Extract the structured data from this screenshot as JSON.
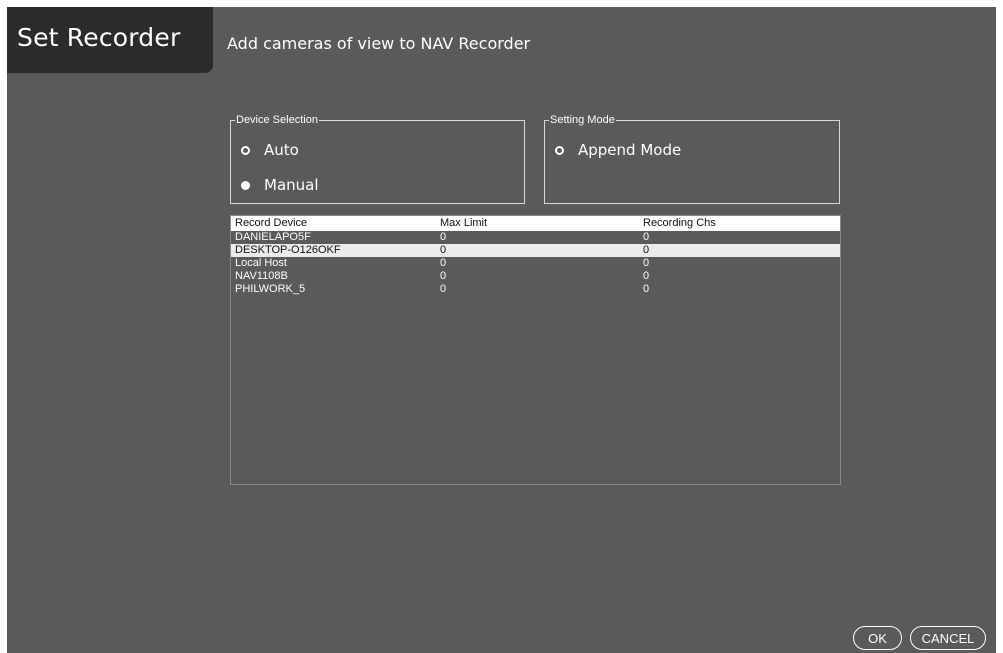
{
  "header": {
    "title": "Set Recorder",
    "subtitle": "Add cameras of view to NAV Recorder"
  },
  "device_selection": {
    "legend": "Device Selection",
    "options": [
      {
        "label": "Auto",
        "selected": false
      },
      {
        "label": "Manual",
        "selected": true
      }
    ]
  },
  "setting_mode": {
    "legend": "Setting Mode",
    "options": [
      {
        "label": "Append Mode",
        "selected": false
      }
    ]
  },
  "table": {
    "columns": [
      "Record Device",
      "Max Limit",
      "Recording Chs"
    ],
    "rows": [
      {
        "device": "DANIELAPO5F",
        "max_limit": "0",
        "recording_chs": "0",
        "selected": false
      },
      {
        "device": "DESKTOP-O126OKF",
        "max_limit": "0",
        "recording_chs": "0",
        "selected": true
      },
      {
        "device": "Local Host",
        "max_limit": "0",
        "recording_chs": "0",
        "selected": false
      },
      {
        "device": "NAV1108B",
        "max_limit": "0",
        "recording_chs": "0",
        "selected": false
      },
      {
        "device": "PHILWORK_5",
        "max_limit": "0",
        "recording_chs": "0",
        "selected": false
      }
    ]
  },
  "buttons": {
    "ok": "OK",
    "cancel": "CANCEL"
  },
  "colors": {
    "background": "#5a5a5a",
    "title_tab": "#2b2b2b",
    "text": "#ffffff",
    "selected_row": "#ebebeb"
  }
}
